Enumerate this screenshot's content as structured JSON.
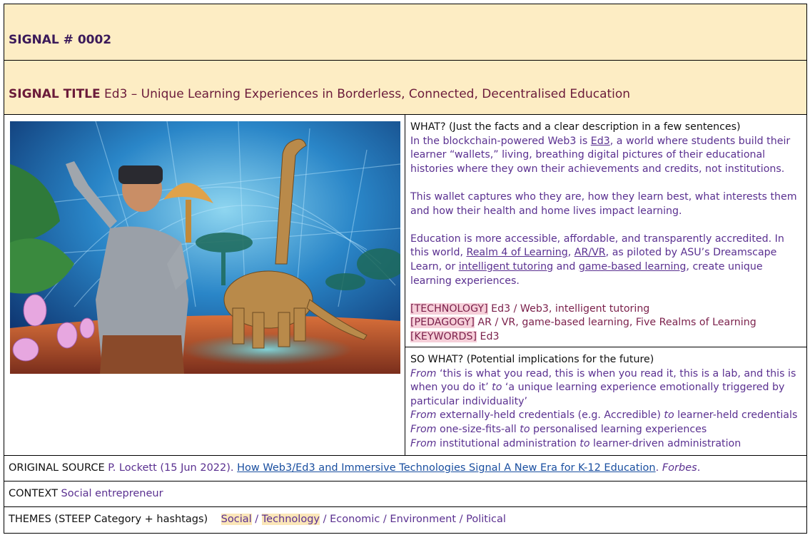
{
  "signal": {
    "label": "SIGNAL # 0002"
  },
  "title": {
    "label": "SIGNAL TITLE",
    "value": "Ed3 – Unique Learning Experiences in Borderless, Connected, Decentralised Education"
  },
  "what": {
    "heading": "WHAT? (Just the facts and a clear description in a few sentences)",
    "p1_a": "In the blockchain-powered Web3 is ",
    "p1_link": "Ed3",
    "p1_b": ", a world where students build their learner “wallets,” living, breathing digital pictures of their educational histories where they own their achievements and credits, not institutions.",
    "p2": "This wallet captures who they are, how they learn best, what interests them and how their health and home lives impact learning.",
    "p3_a": "Education is more accessible, affordable, and transparently accredited. In this world, ",
    "p3_link1": "Realm 4 of Learning",
    "p3_b": ", ",
    "p3_link2": "AR/VR",
    "p3_c": ", as piloted by ASU’s Dreamscape Learn, or ",
    "p3_link3": "intelligent tutoring",
    "p3_d": " and ",
    "p3_link4": "game-based learning",
    "p3_e": ", create unique learning experiences.",
    "tags": [
      {
        "name": "TECHNOLOGY",
        "value": " Ed3 / Web3, intelligent tutoring"
      },
      {
        "name": "PEDAGOGY",
        "value": " AR / VR, game-based learning, Five Realms of Learning"
      },
      {
        "name": "KEYWORDS",
        "value": " Ed3"
      }
    ]
  },
  "sowhat": {
    "heading": "SO WHAT? (Potential implications for the future)",
    "lines": [
      {
        "from": "From",
        "a": " ‘this is what you read, this is when you read it, this is a lab, and this is when you do it’ ",
        "to": "to",
        "b": " ‘a unique learning experience emotionally triggered by particular individuality’"
      },
      {
        "from": "From",
        "a": " externally-held credentials (e.g. Accredible) ",
        "to": "to",
        "b": " learner-held credentials"
      },
      {
        "from": "From",
        "a": " one-size-fits-all ",
        "to": "to",
        "b": " personalised learning experiences"
      },
      {
        "from": "From",
        "a": " institutional administration ",
        "to": "to",
        "b": " learner-driven administration"
      }
    ]
  },
  "source": {
    "label": "ORIGINAL SOURCE",
    "author": " P. Lockett (15 Jun 2022). ",
    "link": "How Web3/Ed3 and Immersive Technologies Signal A New Era for K-12 Education",
    "sep": ". ",
    "publication": "Forbes",
    "end": "."
  },
  "context": {
    "label": "CONTEXT",
    "value": " Social entrepreneur"
  },
  "themes": {
    "label": "THEMES (STEEP Category + hashtags)",
    "items": [
      "Social",
      "Technology",
      "Economic",
      "Environment",
      "Political"
    ],
    "sep": " / "
  },
  "colors": {
    "header_bg": "#fdedc4",
    "purple": "#5a3090",
    "maroon": "#6b1b3a",
    "link": "#1a4fa0",
    "tag_highlight": "#f6cfd9"
  }
}
